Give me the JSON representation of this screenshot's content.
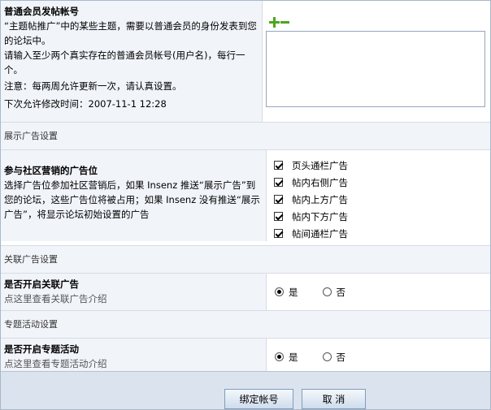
{
  "account": {
    "title": "普通会员发帖帐号",
    "desc1": "“主题帖推广”中的某些主题，需要以普通会员的身份发表到您的论坛中。",
    "desc2": "请输入至少两个真实存在的普通会员帐号(用户名)，每行一个。",
    "note": "注意：每两周允许更新一次，请认真设置。",
    "next_time": "下次允许修改时间：2007-11-1 12:28",
    "input_value": ""
  },
  "display_ads": {
    "section_title": "展示广告设置",
    "title": "参与社区营销的广告位",
    "desc": "选择广告位参加社区营销后，如果 Insenz 推送“展示广告”到您的论坛，这些广告位将被占用；如果 Insenz 没有推送“展示广告”，将显示论坛初始设置的广告",
    "positions": [
      {
        "label": "页头通栏广告",
        "checked": true
      },
      {
        "label": "帖内右侧广告",
        "checked": true
      },
      {
        "label": "帖内上方广告",
        "checked": true
      },
      {
        "label": "帖内下方广告",
        "checked": true
      },
      {
        "label": "帖间通栏广告",
        "checked": true
      }
    ]
  },
  "related_ads": {
    "section_title": "关联广告设置",
    "title": "是否开启关联广告",
    "link": "点这里查看关联广告介绍",
    "yes": "是",
    "no": "否",
    "selected": "yes"
  },
  "special": {
    "section_title": "专题活动设置",
    "title": "是否开启专题活动",
    "link": "点这里查看专题活动介绍",
    "yes": "是",
    "no": "否",
    "selected": "yes"
  },
  "buttons": {
    "bind": "绑定帐号",
    "cancel": "取 消"
  }
}
